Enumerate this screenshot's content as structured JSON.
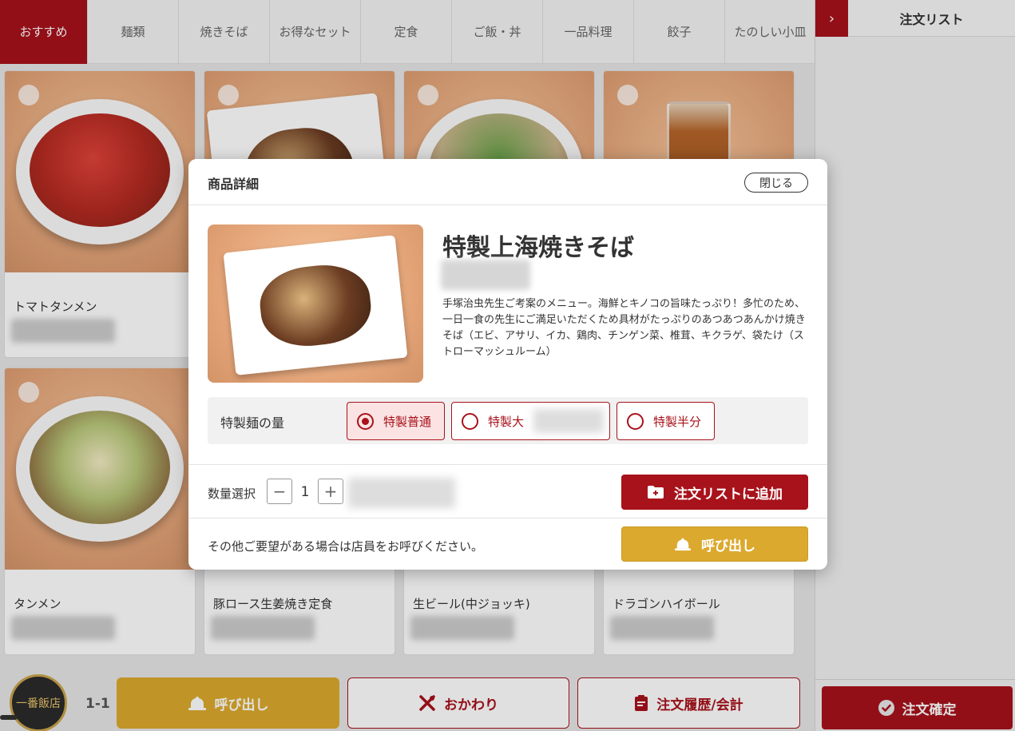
{
  "tabs": [
    {
      "label": "おすすめ"
    },
    {
      "label": "麺類"
    },
    {
      "label": "焼きそば"
    },
    {
      "label": "お得なセット"
    },
    {
      "label": "定食"
    },
    {
      "label": "ご飯・丼"
    },
    {
      "label": "一品料理"
    },
    {
      "label": "餃子"
    },
    {
      "label": "たのしい小皿"
    }
  ],
  "menu_items": [
    {
      "name": "トマトタンメン"
    },
    {
      "name": ""
    },
    {
      "name": ""
    },
    {
      "name": ""
    },
    {
      "name": "タンメン"
    },
    {
      "name": "豚ロース生姜焼き定食"
    },
    {
      "name": "生ビール(中ジョッキ)"
    },
    {
      "name": "ドラゴンハイボール"
    }
  ],
  "bottom": {
    "logo_text": "一番飯店",
    "table_no": "1-1",
    "call_label": "呼び出し",
    "refill_label": "おかわり",
    "history_label": "注文履歴/会計"
  },
  "panel": {
    "toggle_icon": "›",
    "title": "注文リスト",
    "confirm_label": "注文確定"
  },
  "modal": {
    "header": "商品詳細",
    "close_label": "閉じる",
    "name": "特製上海焼きそば",
    "description": "手塚治虫先生ご考案のメニュー。海鮮とキノコの旨味たっぷり！多忙のため、一日一食の先生にご満足いただくため具材がたっぷりのあつあつあんかけ焼きそば（エビ、アサリ、イカ、鶏肉、チンゲン菜、椎茸、キクラゲ、袋たけ（ストローマッシュルーム）",
    "option_label": "特製麺の量",
    "options": [
      {
        "label": "特製普通",
        "selected": true
      },
      {
        "label": "特製大",
        "selected": false
      },
      {
        "label": "特製半分",
        "selected": false
      }
    ],
    "qty_label": "数量選択",
    "qty_minus": "−",
    "qty_value": "1",
    "qty_plus": "+",
    "add_label": "注文リストに追加",
    "call_note": "その他ご要望がある場合は店員をお呼びください。",
    "call_label": "呼び出し"
  },
  "colors": {
    "accent": "#a8121b",
    "call": "#dba92d"
  },
  "icons": {
    "bell": "bell-icon",
    "utensils": "utensils-icon",
    "clipboard": "clipboard-icon",
    "check": "check-circle-icon",
    "folder_plus": "folder-plus-icon"
  }
}
